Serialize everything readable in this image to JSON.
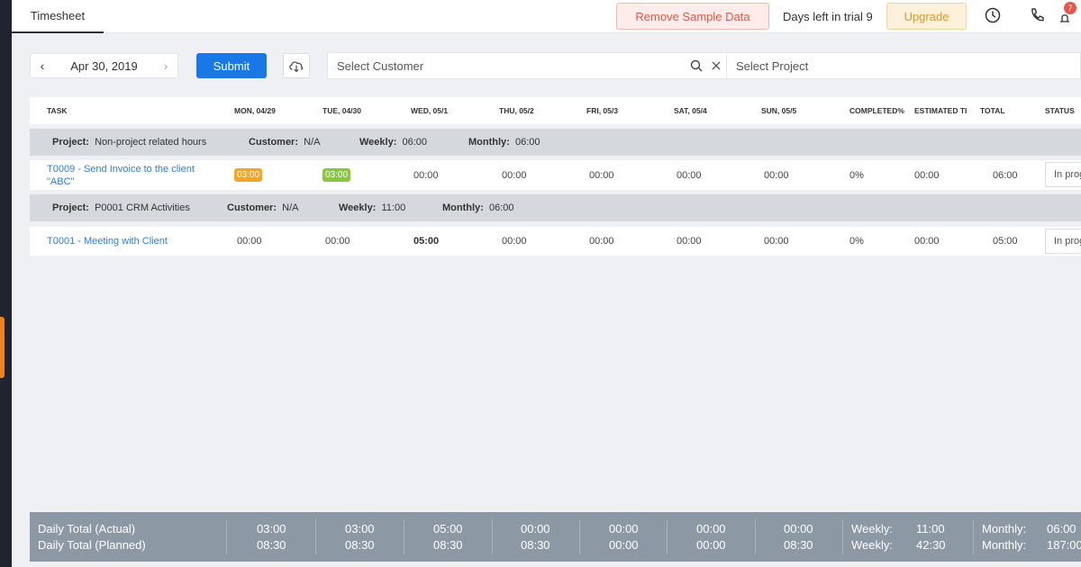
{
  "topbar": {
    "tab_label": "Timesheet",
    "remove_sample_label": "Remove Sample Data",
    "trial_text": "Days left in trial 9",
    "upgrade_label": "Upgrade",
    "notification_count": "7"
  },
  "toolbar": {
    "date": "Apr 30, 2019",
    "submit_label": "Submit",
    "customer_placeholder": "Select Customer",
    "project_placeholder": "Select Project"
  },
  "table": {
    "headers": {
      "task": "TASK",
      "mon": "MON, 04/29",
      "tue": "TUE, 04/30",
      "wed": "WED, 05/1",
      "thu": "THU, 05/2",
      "fri": "FRI, 05/3",
      "sat": "SAT, 05/4",
      "sun": "SUN, 05/5",
      "completed": "COMPLETED%",
      "estimated": "ESTIMATED TI",
      "total": "TOTAL",
      "status": "STATUS"
    },
    "groups": [
      {
        "project_label": "Project:",
        "project_value": "Non-project related hours",
        "customer_label": "Customer:",
        "customer_value": "N/A",
        "weekly_label": "Weekly:",
        "weekly_value": "06:00",
        "monthly_label": "Monthly:",
        "monthly_value": "06:00",
        "task": {
          "name": "T0009 - Send Invoice to the client \"ABC\"",
          "mon": "03:00",
          "tue": "03:00",
          "wed": "00:00",
          "thu": "00:00",
          "fri": "00:00",
          "sat": "00:00",
          "sun": "00:00",
          "completed": "0%",
          "estimated": "00:00",
          "total": "06:00",
          "status": "In progress"
        }
      },
      {
        "project_label": "Project:",
        "project_value": "P0001 CRM Activities",
        "customer_label": "Customer:",
        "customer_value": "N/A",
        "weekly_label": "Weekly:",
        "weekly_value": "11:00",
        "monthly_label": "Monthly:",
        "monthly_value": "06:00",
        "task": {
          "name": "T0001 - Meeting with Client",
          "mon": "00:00",
          "tue": "00:00",
          "wed": "05:00",
          "thu": "00:00",
          "fri": "00:00",
          "sat": "00:00",
          "sun": "00:00",
          "completed": "0%",
          "estimated": "00:00",
          "total": "05:00",
          "status": "In progress"
        }
      }
    ]
  },
  "footer": {
    "actual_label": "Daily Total (Actual)",
    "planned_label": "Daily Total (Planned)",
    "days": [
      {
        "actual": "03:00",
        "planned": "08:30"
      },
      {
        "actual": "03:00",
        "planned": "08:30"
      },
      {
        "actual": "05:00",
        "planned": "08:30"
      },
      {
        "actual": "00:00",
        "planned": "08:30"
      },
      {
        "actual": "00:00",
        "planned": "00:00"
      },
      {
        "actual": "00:00",
        "planned": "00:00"
      },
      {
        "actual": "00:00",
        "planned": "08:30"
      }
    ],
    "weekly_label": "Weekly:",
    "weekly_actual": "11:00",
    "weekly_planned": "42:30",
    "monthly_label": "Monthly:",
    "monthly_actual": "06:00",
    "monthly_planned": "187:00"
  },
  "colors": {
    "primary": "#1878e8",
    "mon_chip": "#f5a623",
    "tue_chip": "#8cc63f",
    "danger": "#e4574a",
    "warning": "#d8962a"
  }
}
